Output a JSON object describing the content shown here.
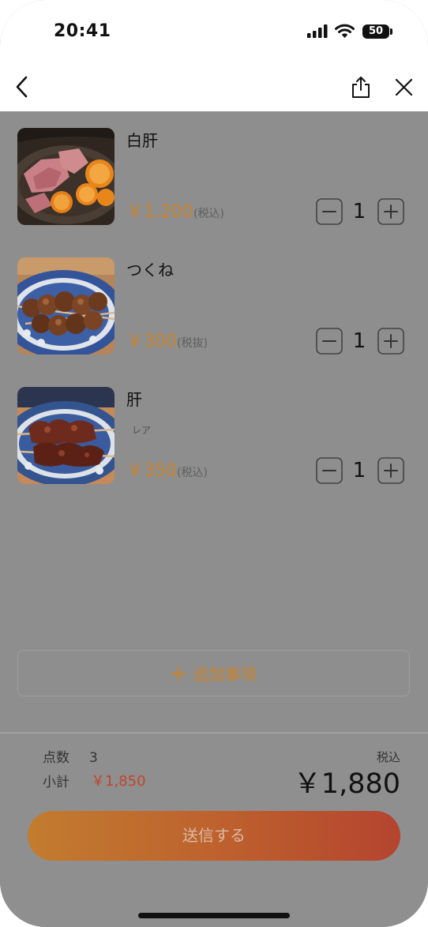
{
  "status_bar": {
    "time": "20:41",
    "battery": "50",
    "icons": [
      "signal-icon",
      "wifi-icon",
      "battery-icon"
    ]
  },
  "nav": {
    "back_icon": "chevron-left-icon",
    "share_icon": "share-icon",
    "close_icon": "close-icon"
  },
  "items": [
    {
      "name": "白肝",
      "note": "",
      "price": "￥1,200",
      "tax": "(税込)",
      "qty": "1"
    },
    {
      "name": "つくね",
      "note": "",
      "price": "￥300",
      "tax": "(税抜)",
      "qty": "1"
    },
    {
      "name": "肝",
      "note": "レア",
      "price": "￥350",
      "tax": "(税込)",
      "qty": "1"
    }
  ],
  "add_notes": {
    "icon": "plus-icon",
    "label": "追加事項"
  },
  "summary": {
    "count_label": "点数",
    "count": "3",
    "subtotal_label": "小計",
    "subtotal": "￥1,850",
    "tax_label": "税込",
    "total": "￥1,880"
  },
  "submit": {
    "label": "送信する"
  },
  "colors": {
    "accent": "#c8832f",
    "subtotal": "#c2432b",
    "overlay": "#8e8e8e",
    "button_gradient_start": "#c27c2f",
    "button_gradient_end": "#b4442f"
  }
}
